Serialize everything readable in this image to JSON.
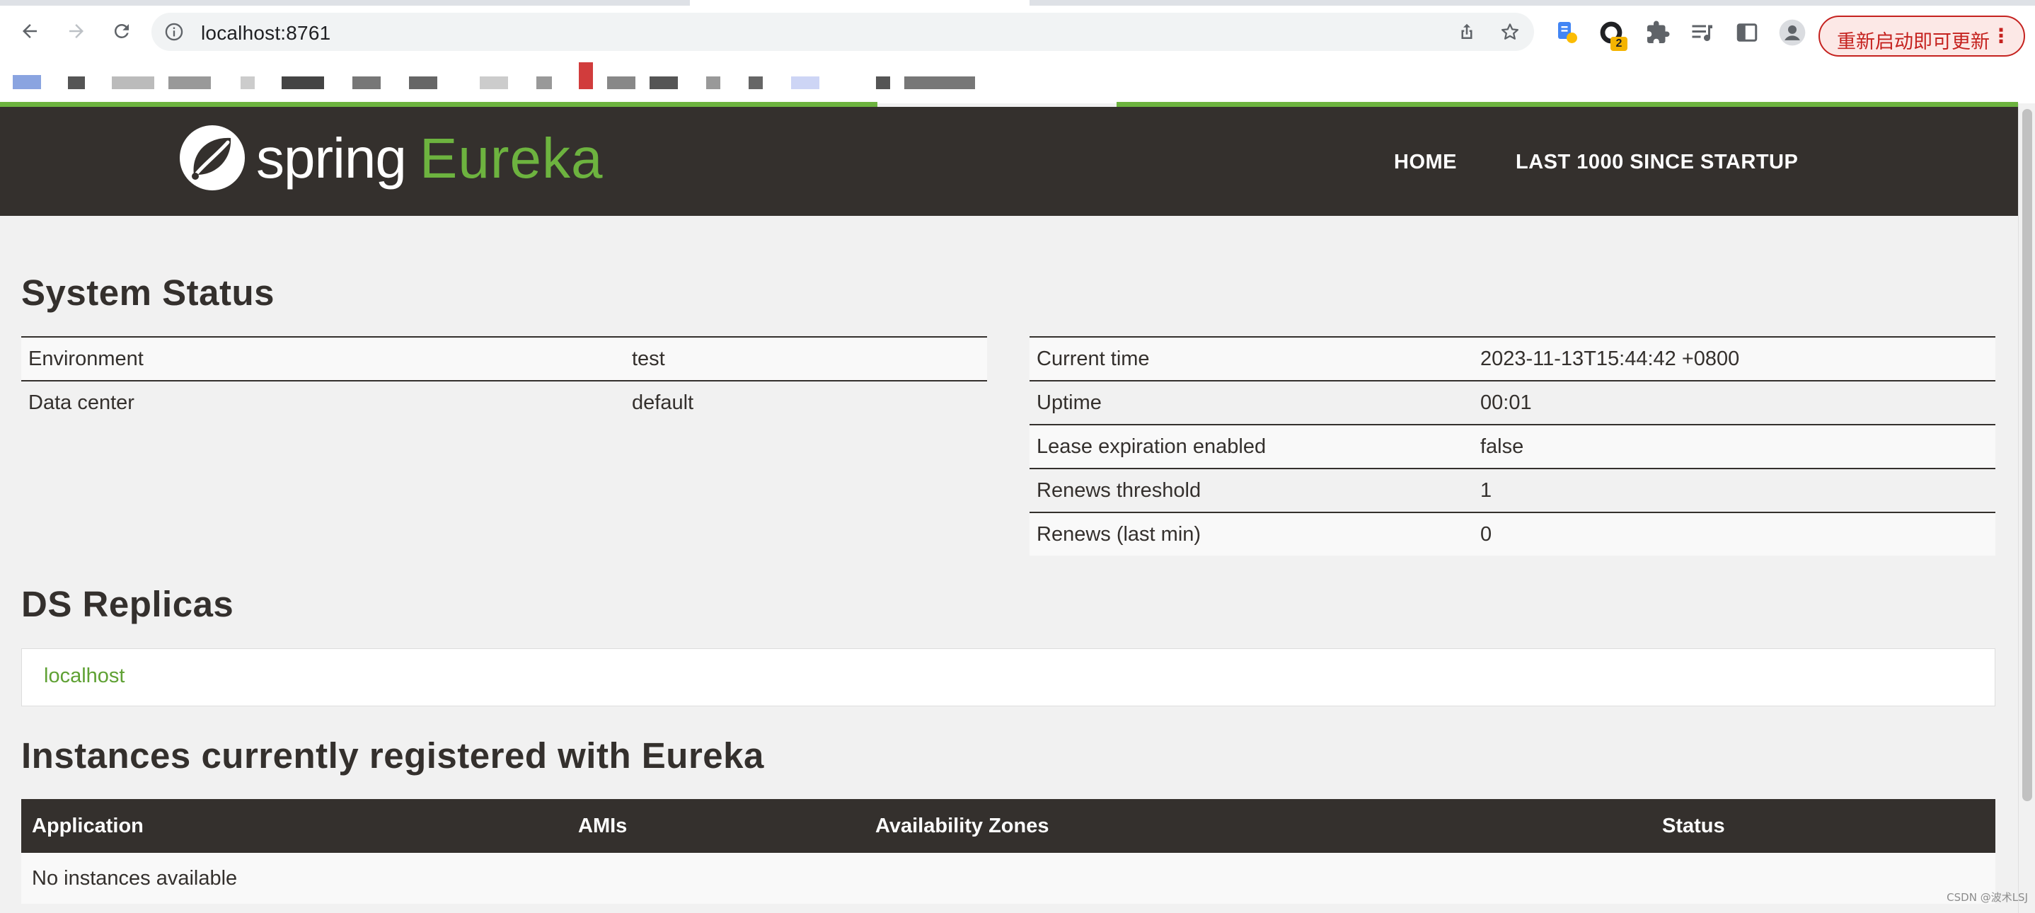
{
  "browser": {
    "url": "localhost:8761",
    "update_button_label": "重新启动即可更新",
    "menu_label": "⋮",
    "extension_badge": "2"
  },
  "navbar": {
    "brand_primary": "spring",
    "brand_secondary": "Eureka",
    "links": [
      "HOME",
      "LAST 1000 SINCE STARTUP"
    ]
  },
  "system_status": {
    "title": "System Status",
    "left": [
      {
        "label": "Environment",
        "value": "test"
      },
      {
        "label": "Data center",
        "value": "default"
      }
    ],
    "right": [
      {
        "label": "Current time",
        "value": "2023-11-13T15:44:42 +0800"
      },
      {
        "label": "Uptime",
        "value": "00:01"
      },
      {
        "label": "Lease expiration enabled",
        "value": "false"
      },
      {
        "label": "Renews threshold",
        "value": "1"
      },
      {
        "label": "Renews (last min)",
        "value": "0"
      }
    ]
  },
  "ds_replicas": {
    "title": "DS Replicas",
    "items": [
      "localhost"
    ]
  },
  "instances": {
    "title": "Instances currently registered with Eureka",
    "columns": [
      "Application",
      "AMIs",
      "Availability Zones",
      "Status"
    ],
    "empty_message": "No instances available"
  },
  "watermark": "CSDN @波术LSJ",
  "colors": {
    "brand_green": "#6db33f",
    "navbar_bg": "#34302d",
    "page_bg": "#f1f1f1",
    "update_red": "#c5221f"
  }
}
